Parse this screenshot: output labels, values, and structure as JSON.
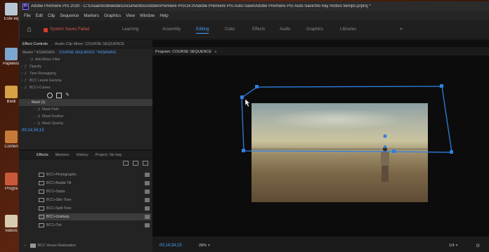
{
  "desktop": {
    "icons": [
      {
        "label": "Este eq",
        "color": "#d0d0d0"
      },
      {
        "label": "Papelera",
        "color": "#6aa0d0"
      },
      {
        "label": "Bwdi",
        "color": "#c89030"
      },
      {
        "label": "Conten",
        "color": "#c07030"
      },
      {
        "label": "Progra",
        "color": "#d05030"
      },
      {
        "label": "videos",
        "color": "#d0c0a0"
      }
    ]
  },
  "window": {
    "title": "Adobe Premiere Pro 2020 - C:\\Usuarios\\Bwelda\\Documentos\\Adobe\\Premiere Pro\\14.0\\Adobe Premiere Pro Auto-Save\\Adobe Premiere Pro Auto-Save\\No hay motivo tiempo.prproj *",
    "logo": "Pr",
    "menu": [
      "File",
      "Edit",
      "Clip",
      "Sequence",
      "Markers",
      "Graphics",
      "View",
      "Window",
      "Help"
    ]
  },
  "workspace": {
    "autosave_text": "System Saves Failed",
    "tabs": [
      "Learning",
      "Assembly",
      "Editing",
      "Color",
      "Effects",
      "Audio",
      "Graphics",
      "Libraries"
    ],
    "active_tab": "Editing",
    "more": "»"
  },
  "effect_controls": {
    "tabs": [
      "Effect Controls",
      "Audio Clip Mixer: COURSE SEQUENCE"
    ],
    "master_label": "Master * ASSAISAIS",
    "sequence_label": "COURSE SEQUENCE * ASSAISAIS",
    "rows": [
      {
        "label": "Anti-flicker Filter",
        "indent": 1
      },
      {
        "label": "Opacity",
        "indent": 0
      },
      {
        "label": "Time Remapping",
        "indent": 0
      },
      {
        "label": "BCC Levels Gamma",
        "indent": 0
      },
      {
        "label": "BCC+Curves",
        "indent": 0
      }
    ],
    "mask_label": "Mask (1)",
    "mask_rows": [
      "Mask Path",
      "Mask Feather",
      "Mask Opacity"
    ],
    "timecode": "00;14;34;15"
  },
  "effects": {
    "tabs": [
      "Effects",
      "Markers",
      "History",
      "Project: No hay"
    ],
    "items": [
      "BCC+Photographic",
      "BCC+Radial Tilt",
      "BCC+Sepia",
      "BCC+Skin Tone",
      "BCC+Split Tone",
      "BCC+Unsharp",
      "BCC+Tint"
    ],
    "selected_index": 5,
    "folder": "BCC Versus Restoration"
  },
  "program": {
    "title": "Program: COURSE SEQUENCE",
    "menu_icon": "≡",
    "timecode": "00;14;34;15",
    "zoom": "28%",
    "resolution": "1/4",
    "mask_color": "#2f7fe0"
  }
}
